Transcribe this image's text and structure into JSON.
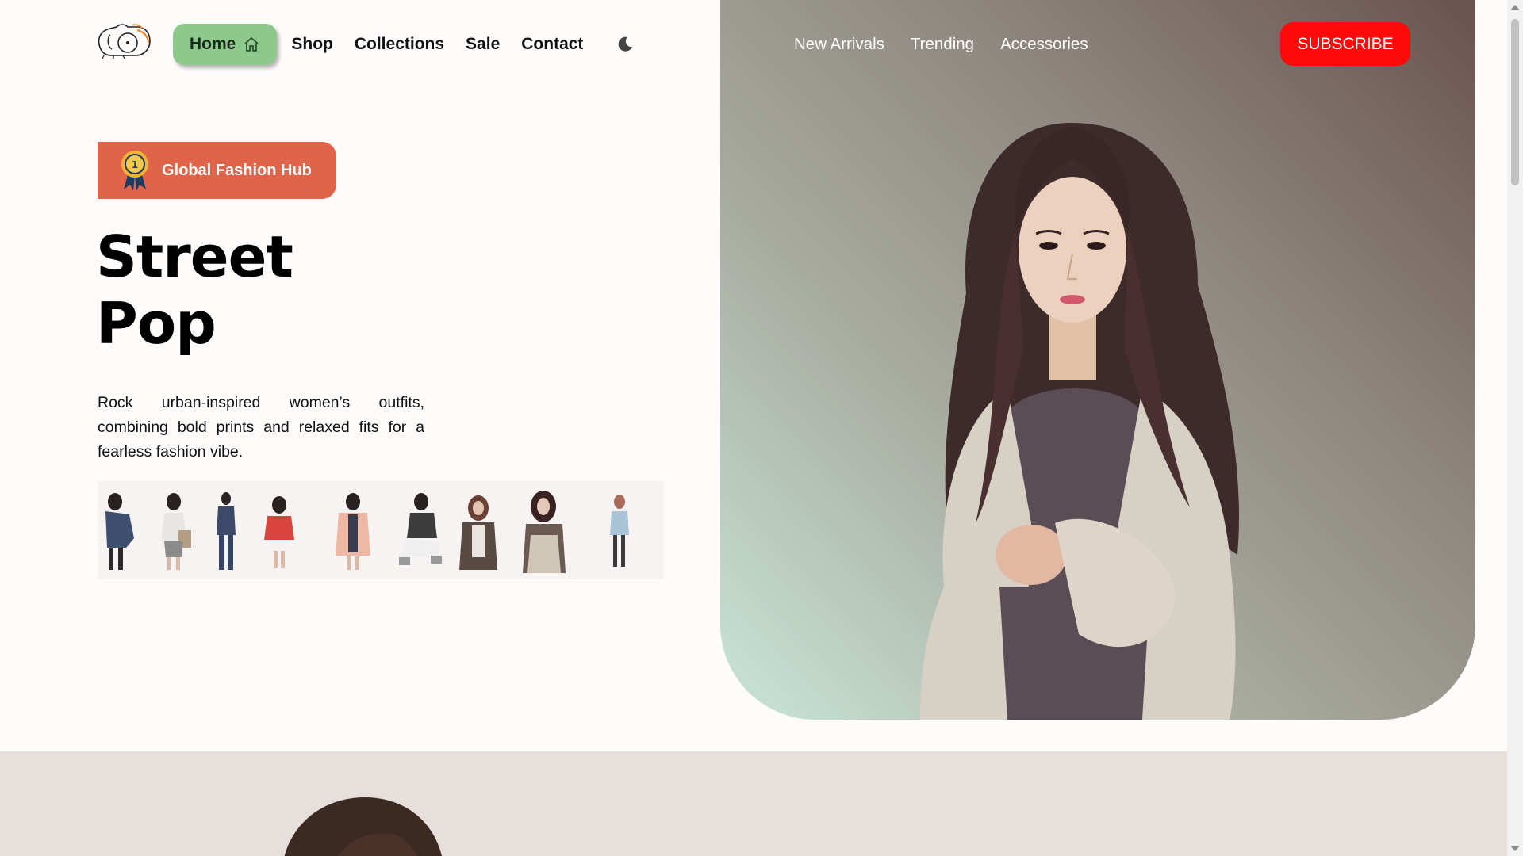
{
  "nav": {
    "home_label": "Home",
    "links": [
      "Shop",
      "Collections",
      "Sale",
      "Contact"
    ],
    "theme_toggle_icon": "moon-icon"
  },
  "nav_right": {
    "links": [
      "New Arrivals",
      "Trending",
      "Accessories"
    ],
    "subscribe_label": "SUBSCRIBE"
  },
  "hero": {
    "badge_text": "Global Fashion Hub",
    "badge_icon": "award-ribbon-icon",
    "title_line1": "Street",
    "title_line2": "Pop",
    "description": "Rock urban-inspired women’s outfits, combining bold prints and relaxed fits for a fearless fashion vibe."
  },
  "colors": {
    "home_button": "#8dc98d",
    "badge": "#e0644a",
    "subscribe": "#ff0a0a",
    "lower_section": "#e6dfdb"
  }
}
